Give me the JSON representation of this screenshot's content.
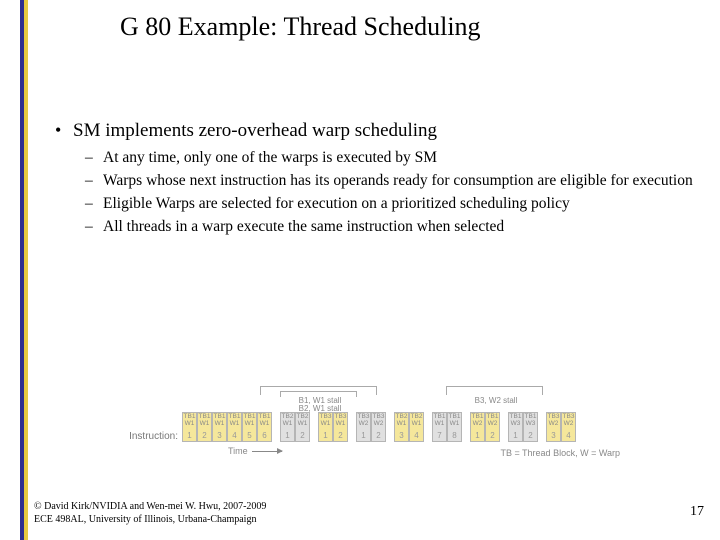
{
  "title": "G 80 Example: Thread Scheduling",
  "main_bullet": "SM implements zero-overhead warp scheduling",
  "subpoints": [
    "At any time, only one of the warps is executed by SM",
    "Warps whose next instruction has its operands ready for consumption are eligible for execution",
    "Eligible Warps are selected for execution on a prioritized scheduling policy",
    "All threads in a warp execute the same instruction when selected"
  ],
  "diagram": {
    "instruction_label": "Instruction:",
    "time_label": "Time",
    "legend": "TB = Thread Block, W = Warp",
    "stalls": {
      "left": [
        "B1, W1 stall",
        "B2, W1 stall"
      ],
      "right": [
        "B3, W2 stall"
      ]
    },
    "groups": [
      {
        "color": "y",
        "labels": [
          "TB1\nW1",
          "TB1\nW1",
          "TB1\nW1",
          "TB1\nW1",
          "TB1\nW1",
          "TB1\nW1"
        ],
        "nums": [
          "1",
          "2",
          "3",
          "4",
          "5",
          "6"
        ]
      },
      {
        "color": "g",
        "labels": [
          "TB2\nW1",
          "TB2\nW1"
        ],
        "nums": [
          "1",
          "2"
        ]
      },
      {
        "color": "y",
        "labels": [
          "TB3\nW1",
          "TB3\nW1"
        ],
        "nums": [
          "1",
          "2"
        ]
      },
      {
        "color": "g",
        "labels": [
          "TB3\nW2",
          "TB3\nW2"
        ],
        "nums": [
          "1",
          "2"
        ]
      },
      {
        "color": "y",
        "labels": [
          "TB2\nW1",
          "TB2\nW1"
        ],
        "nums": [
          "3",
          "4"
        ]
      },
      {
        "color": "g",
        "labels": [
          "TB1\nW1",
          "TB1\nW1"
        ],
        "nums": [
          "7",
          "8"
        ]
      },
      {
        "color": "y",
        "labels": [
          "TB1\nW2",
          "TB1\nW2"
        ],
        "nums": [
          "1",
          "2"
        ]
      },
      {
        "color": "g",
        "labels": [
          "TB1\nW3",
          "TB1\nW3"
        ],
        "nums": [
          "1",
          "2"
        ]
      },
      {
        "color": "y",
        "labels": [
          "TB3\nW2",
          "TB3\nW2"
        ],
        "nums": [
          "3",
          "4"
        ]
      }
    ]
  },
  "footer": {
    "line1": "© David Kirk/NVIDIA and Wen-mei W. Hwu, 2007-2009",
    "line2": "ECE 498AL, University of Illinois, Urbana-Champaign"
  },
  "page_number": "17"
}
